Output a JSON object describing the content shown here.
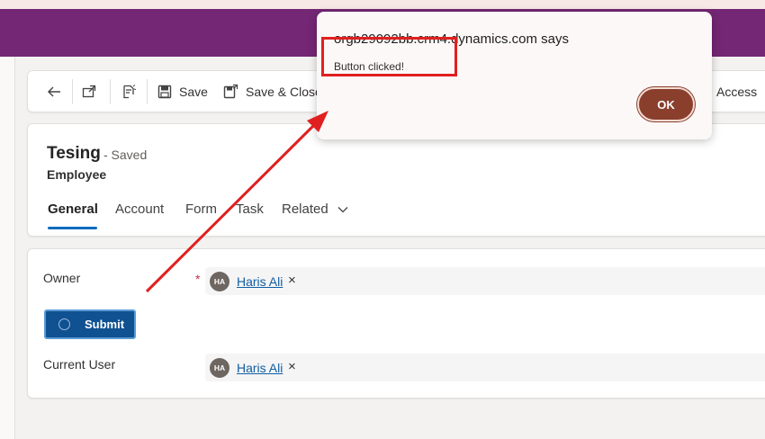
{
  "toolbar": {
    "back_icon": "back-arrow-icon",
    "popout_icon": "open-in-new-window-icon",
    "notes_icon": "note-edit-icon",
    "save_label": "Save",
    "save_close_label": "Save & Close",
    "access_partial": "Access"
  },
  "record": {
    "title": "Tesing",
    "status": "- Saved",
    "entity": "Employee"
  },
  "tabs": [
    {
      "label": "General",
      "active": true
    },
    {
      "label": "Account"
    },
    {
      "label": "Form"
    },
    {
      "label": "Task"
    },
    {
      "label": "Related"
    }
  ],
  "form": {
    "owner_label": "Owner",
    "owner_required": "*",
    "owner_initials": "HA",
    "owner_name": "Haris Ali",
    "owner_remove": "×",
    "submit_label": "Submit",
    "current_user_label": "Current User",
    "current_user_initials": "HA",
    "current_user_name": "Haris Ali",
    "current_user_remove": "×"
  },
  "dialog": {
    "title": "orgb29092bb.crm4.dynamics.com says",
    "message": "Button clicked!",
    "ok_label": "OK"
  },
  "colors": {
    "app_bar": "#742774",
    "accent": "#0f6cbd",
    "submit": "#0f5191",
    "ok_button": "#8a3f2c",
    "annotation": "#e02020"
  }
}
